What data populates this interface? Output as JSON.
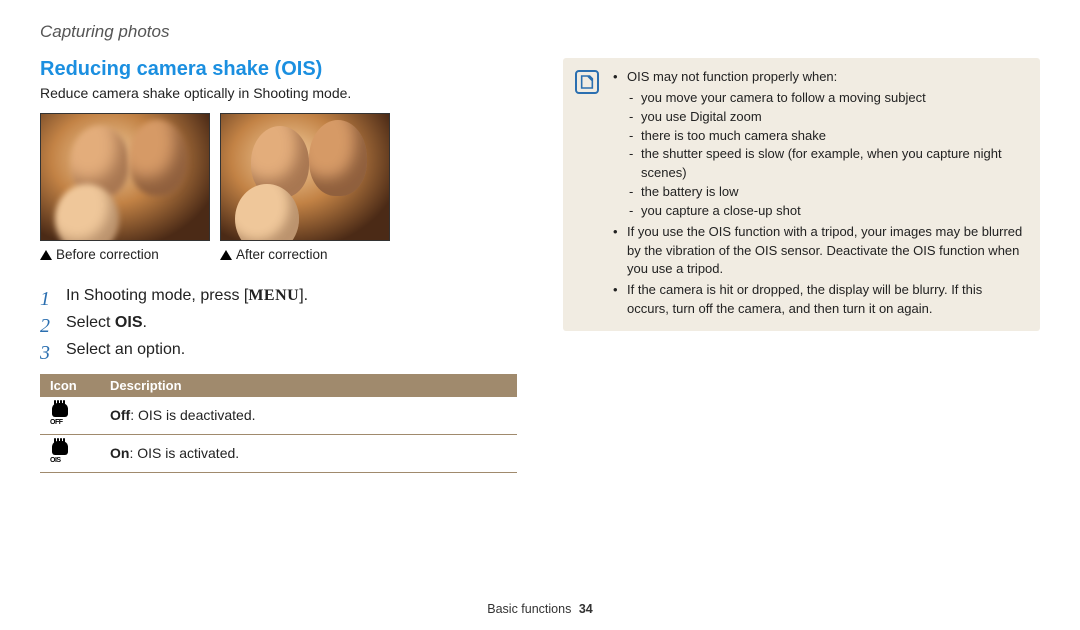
{
  "breadcrumb": "Capturing photos",
  "section_title": "Reducing camera shake (OIS)",
  "intro": "Reduce camera shake optically in Shooting mode.",
  "captions": {
    "before": "Before correction",
    "after": "After correction"
  },
  "steps": {
    "s1_pre": "In Shooting mode, press [",
    "s1_key": "MENU",
    "s1_post": "].",
    "s2_pre": "Select ",
    "s2_bold": "OIS",
    "s2_post": ".",
    "s3": "Select an option."
  },
  "table": {
    "head_icon": "Icon",
    "head_desc": "Description",
    "row_off_bold": "Off",
    "row_off_rest": ": OIS is deactivated.",
    "row_on_bold": "On",
    "row_on_rest": ": OIS is activated.",
    "icon_off_sub": "OFF",
    "icon_on_sub": "OIS"
  },
  "note": {
    "b1": "OIS may not function properly when:",
    "b1a": "you move your camera to follow a moving subject",
    "b1b": "you use Digital zoom",
    "b1c": "there is too much camera shake",
    "b1d": "the shutter speed is slow (for example, when you capture night scenes)",
    "b1e": "the battery is low",
    "b1f": "you capture a close-up shot",
    "b2": "If you use the OIS function with a tripod, your images may be blurred by the vibration of the OIS sensor. Deactivate the OIS function when you use a tripod.",
    "b3": "If the camera is hit or dropped, the display will be blurry. If this occurs, turn off the camera, and then turn it on again."
  },
  "footer": {
    "section": "Basic functions",
    "page": "34"
  }
}
